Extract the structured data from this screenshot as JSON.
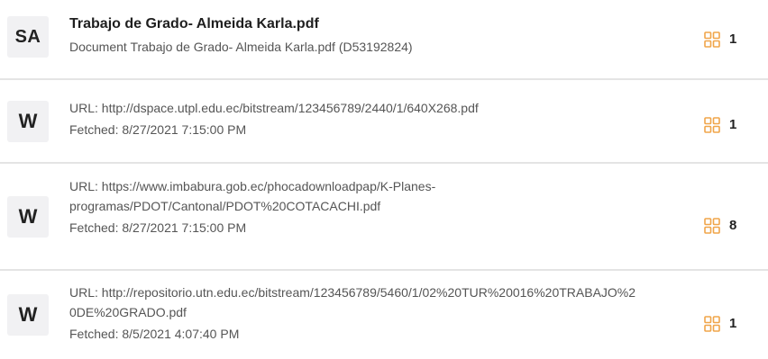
{
  "accent_color": "#f0a54a",
  "sources": [
    {
      "badge": "SA",
      "title": "Trabajo de Grado- Almeida Karla.pdf",
      "subtitle": "Document Trabajo de Grado- Almeida Karla.pdf (D53192824)",
      "icon": "blocks-icon",
      "count": "1"
    },
    {
      "badge": "W",
      "url": "URL: http://dspace.utpl.edu.ec/bitstream/123456789/2440/1/640X268.pdf",
      "fetched": "Fetched: 8/27/2021 7:15:00 PM",
      "icon": "blocks-icon",
      "count": "1"
    },
    {
      "badge": "W",
      "url_lines": [
        "URL: https://www.imbabura.gob.ec/phocadownloadpap/K-Planes-",
        "programas/PDOT/Cantonal/PDOT%20COTACACHI.pdf"
      ],
      "fetched": "Fetched: 8/27/2021 7:15:00 PM",
      "icon": "blocks-icon",
      "count": "8"
    },
    {
      "badge": "W",
      "url_lines": [
        "URL: http://repositorio.utn.edu.ec/bitstream/123456789/5460/1/02%20TUR%20016%20TRABAJO%2",
        "0DE%20GRADO.pdf"
      ],
      "fetched": "Fetched: 8/5/2021 4:07:40 PM",
      "icon": "blocks-icon",
      "count": "1"
    }
  ]
}
